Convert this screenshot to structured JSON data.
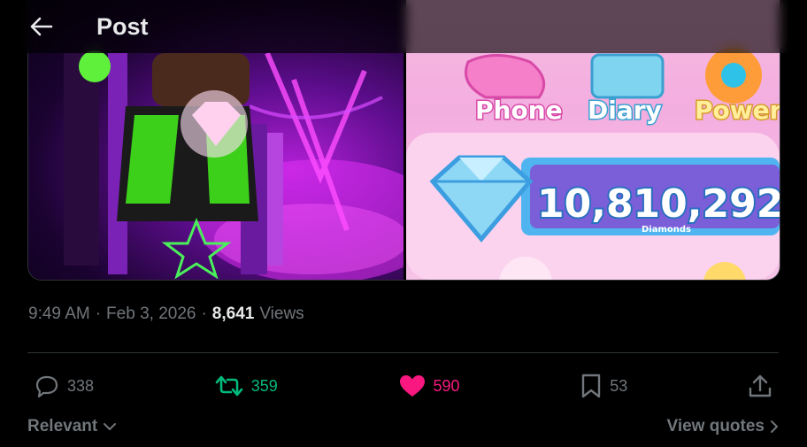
{
  "header": {
    "title": "Post"
  },
  "media": {
    "right_image": {
      "menu_labels": [
        "Phone",
        "Diary",
        "Power"
      ],
      "currency_value": "10,810,292",
      "currency_label": "Diamonds"
    }
  },
  "post_meta": {
    "time": "9:49 AM",
    "separator": "·",
    "date": "Feb 3, 2026",
    "separator2": "·",
    "views_count": "8,641",
    "views_label": "Views"
  },
  "actions": {
    "replies": "338",
    "reposts": "359",
    "likes": "590",
    "bookmarks": "53"
  },
  "footer": {
    "sort_label": "Relevant",
    "quotes_label": "View quotes"
  },
  "colors": {
    "repost_active": "#00ba7c",
    "like_active": "#f91880",
    "muted": "#71767b",
    "text": "#e7e9ea",
    "border": "#2f3336"
  }
}
